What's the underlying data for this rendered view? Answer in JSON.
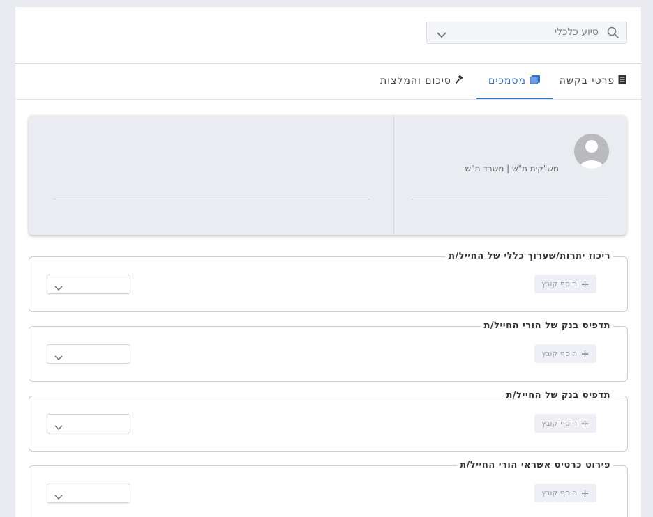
{
  "header": {
    "select_value": "סיוע כלכלי"
  },
  "tabs": [
    {
      "label": "פרטי בקשה",
      "icon": "document-icon"
    },
    {
      "label": "מסמכים",
      "icon": "folder-icon",
      "active": true
    },
    {
      "label": "סיכום והמלצות",
      "icon": "hammer-icon"
    }
  ],
  "profile": {
    "subtitle": "מש\"קית ת\"ש | משרד ת\"ש"
  },
  "documents": [
    {
      "title": "ריכוז יתרות/שערוך כללי של החייל/ת",
      "add_label": "הוסף קובץ"
    },
    {
      "title": "תדפיס בנק של הורי החייל/ת",
      "add_label": "הוסף קובץ"
    },
    {
      "title": "תדפיס בנק של החייל/ת",
      "add_label": "הוסף קובץ"
    },
    {
      "title": "פירוט כרטיס אשראי הורי החייל/ת",
      "add_label": "הוסף קובץ"
    }
  ],
  "colors": {
    "accent": "#2f72c8",
    "background": "#e9eaf0",
    "card": "#ebecf2"
  }
}
